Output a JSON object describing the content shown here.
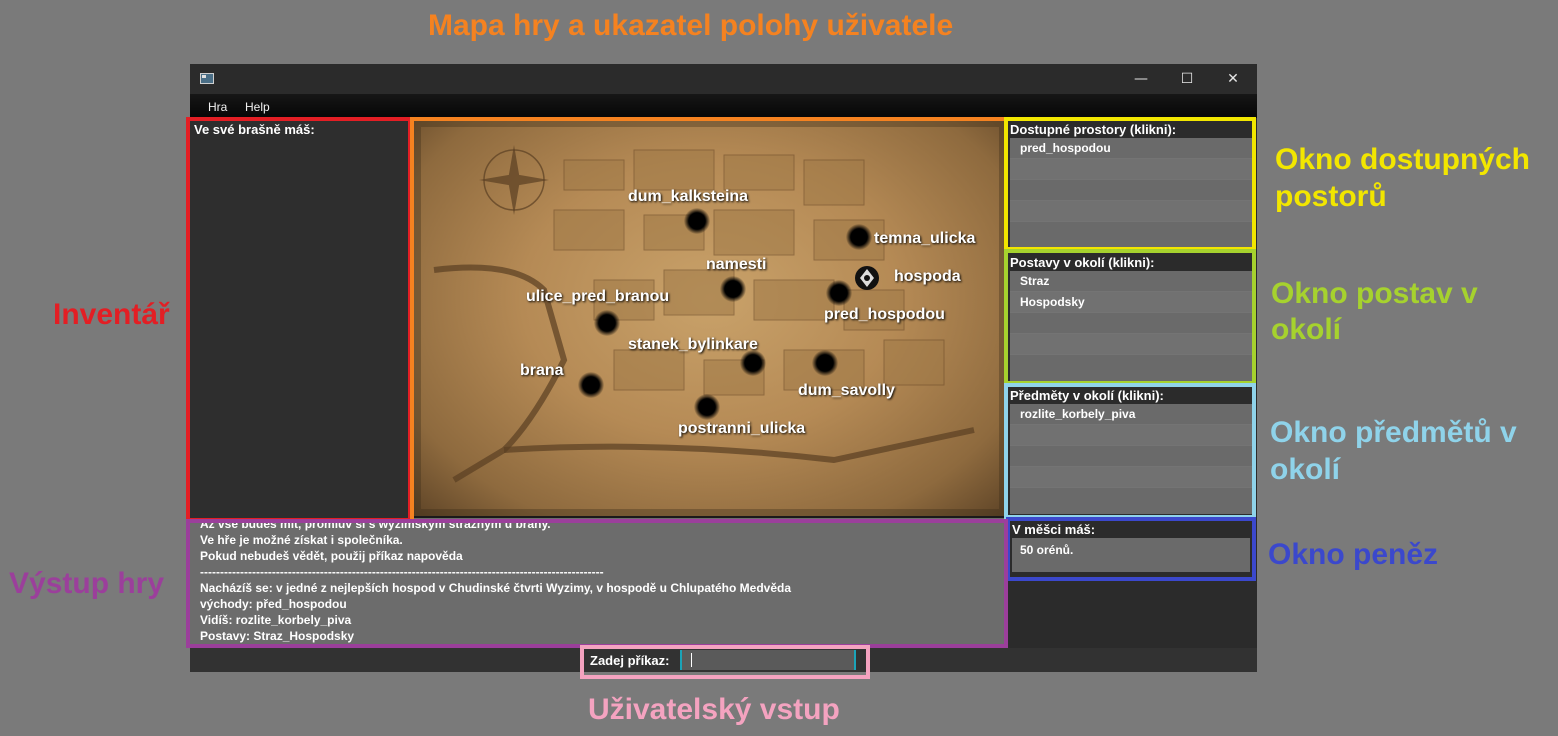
{
  "annotations": {
    "map": "Mapa hry a ukazatel polohy uživatele",
    "inventory": "Inventář",
    "spaces_line1": "Okno dostupných",
    "spaces_line2": "postorů",
    "characters_line1": "Okno postav v",
    "characters_line2": "okolí",
    "items_line1": "Okno předmětů v",
    "items_line2": "okolí",
    "money": "Okno peněz",
    "output": "Výstup hry",
    "input": "Uživatelský vstup"
  },
  "colors": {
    "map": "#f58220",
    "inventory": "#e31e24",
    "spaces": "#f2e600",
    "characters": "#a6d22e",
    "items": "#8fd3ea",
    "money": "#3b48cc",
    "output": "#9b3f9b",
    "input": "#f4a3c0"
  },
  "window": {
    "title_icon": "app-icon",
    "minimize": "—",
    "maximize": "☐",
    "close": "✕"
  },
  "menu": [
    "Hra",
    "Help"
  ],
  "inventory": {
    "label": "Ve své brašně máš:"
  },
  "spaces": {
    "label": "Dostupné prostory (klikni):",
    "items": [
      "pred_hospodou"
    ]
  },
  "characters": {
    "label": "Postavy v okolí (klikni):",
    "items": [
      "Straz",
      "Hospodsky"
    ]
  },
  "items": {
    "label": "Předměty v okolí (klikni):",
    "items": [
      "rozlite_korbely_piva"
    ]
  },
  "money": {
    "label": "V měšci máš:",
    "value": "50 orénů."
  },
  "map_locations": {
    "dum_kalksteina": "dum_kalksteina",
    "temna_ulicka": "temna_ulicka",
    "namesti": "namesti",
    "hospoda": "hospoda",
    "ulice_pred_branou": "ulice_pred_branou",
    "pred_hospodou": "pred_hospodou",
    "stanek_bylinkare": "stanek_bylinkare",
    "brana": "brana",
    "dum_savolly": "dum_savolly",
    "postranni_ulicka": "postranni_ulicka"
  },
  "output": {
    "lines": [
      "Až vše budeš mít, promluv si s wyzimským strážným u brány.",
      "Ve hře je možné získat i společníka.",
      "Pokud nebudeš vědět, použij příkaz napověda",
      "-----------------------------------------------------------------------------------------------------",
      "Nacházíš se: v jedné z nejlepších hospod v Chudinské čtvrti Wyzimy, v hospodě u Chlupatého Medvěda",
      "východy: před_hospodou",
      "Vidíš: rozlite_korbely_piva",
      "Postavy: Straz_Hospodsky"
    ]
  },
  "input": {
    "label": "Zadej příkaz:",
    "value": ""
  }
}
